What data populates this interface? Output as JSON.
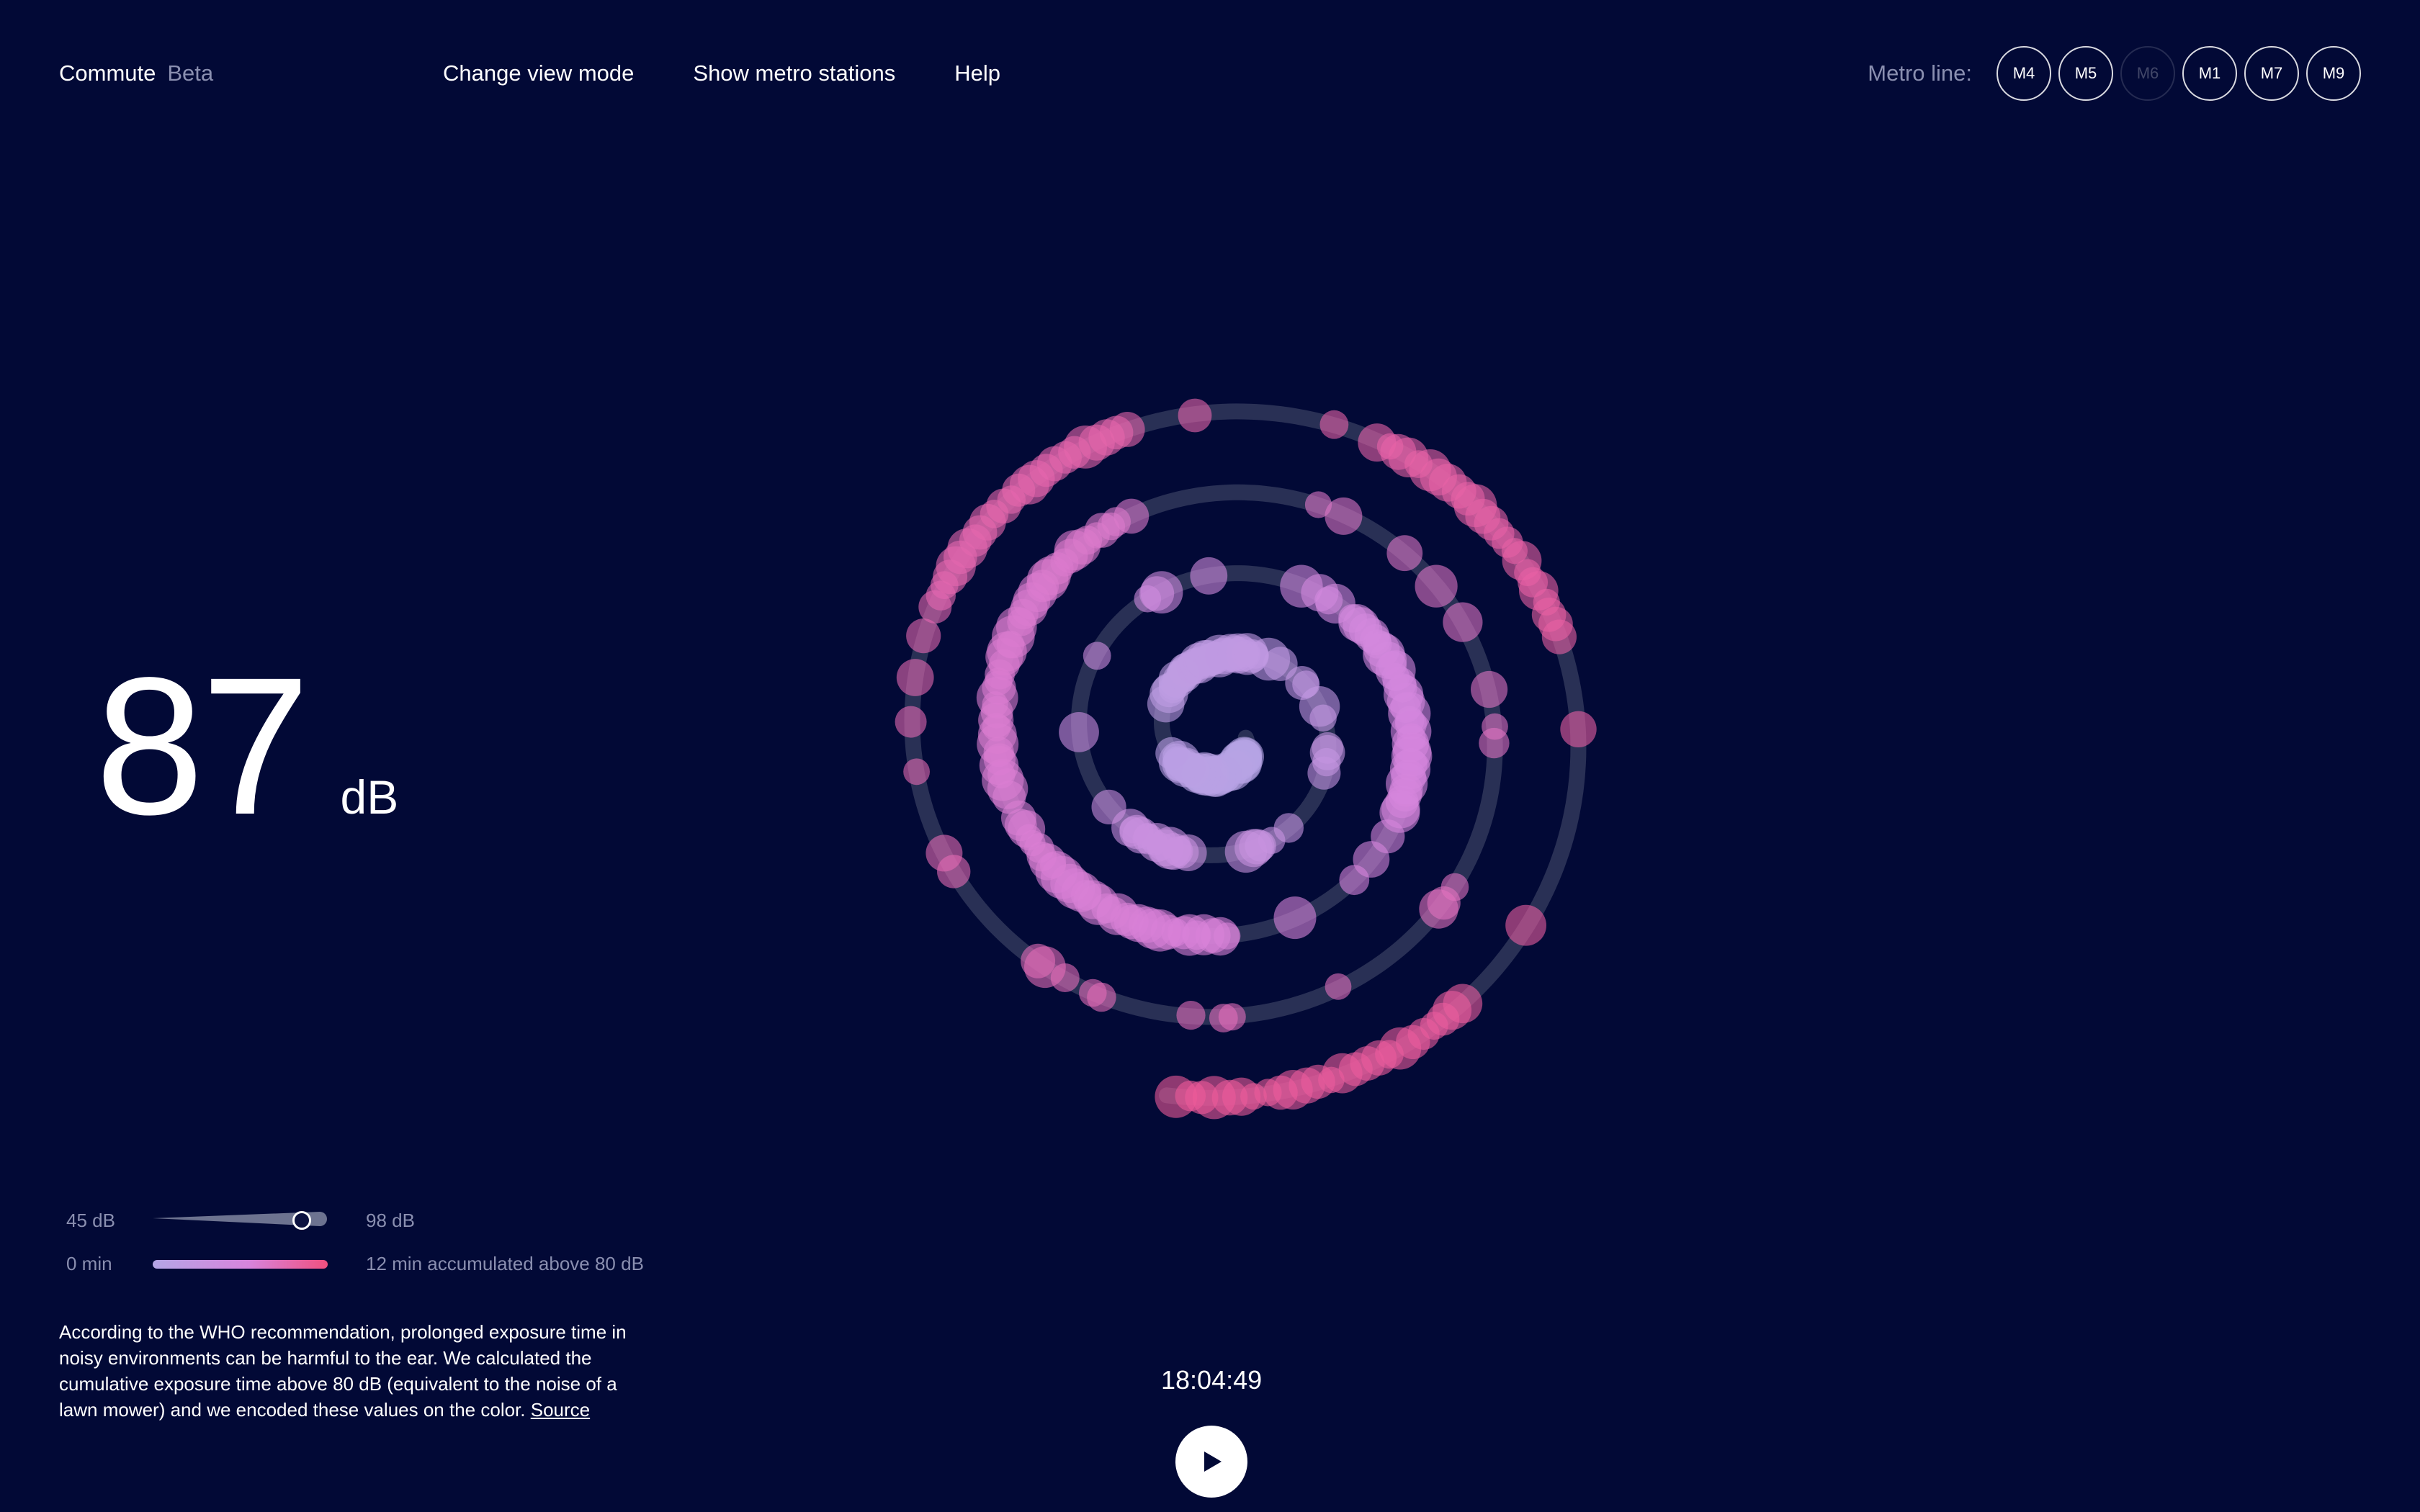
{
  "header": {
    "app_title": "Commute",
    "app_badge": "Beta",
    "nav": {
      "change_view": "Change view mode",
      "show_stations": "Show metro stations",
      "help": "Help"
    },
    "metro": {
      "label": "Metro line:",
      "lines": [
        "M4",
        "M5",
        "M6",
        "M1",
        "M7",
        "M9"
      ],
      "disabled_line": "M6"
    }
  },
  "readout": {
    "value": "87",
    "unit": "dB"
  },
  "legend": {
    "db_min": "45 dB",
    "db_max": "98 dB",
    "db_current_fraction": 0.85,
    "time_min": "0 min",
    "time_label": "12 min accumulated above 80 dB",
    "gradient_colors": [
      "#b4a6e6",
      "#d784dc",
      "#f0507f"
    ]
  },
  "note": {
    "text": "According to the WHO recommendation, prolonged exposure time in noisy environments can be harmful to the ear. We calculated the cumulative exposure time above 80 dB (equivalent to the noise of a lawn mower) and we encoded these values on the color.",
    "source_link": "Source"
  },
  "player": {
    "time": "18:04:49",
    "play_icon": "play-icon"
  },
  "colors": {
    "background": "#020936",
    "track": "#4a5170",
    "low_exposure": "#b4a6e6",
    "mid_exposure": "#d784dc",
    "high_exposure": "#ec5a9a"
  }
}
